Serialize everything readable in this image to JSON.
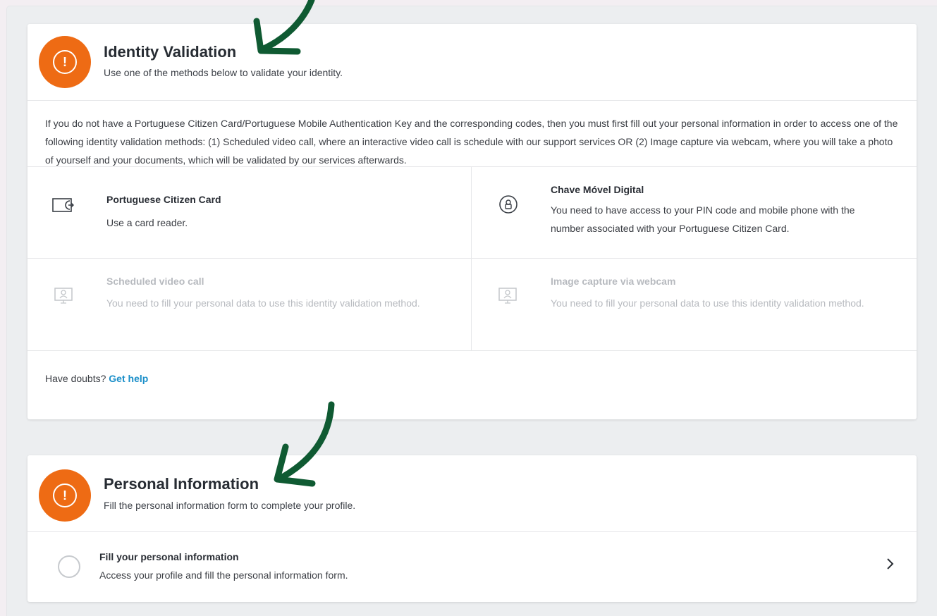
{
  "identity": {
    "title": "Identity Validation",
    "subtitle": "Use one of the methods below to validate your identity.",
    "intro": "If you do not have a Portuguese Citizen Card/Portuguese Mobile Authentication Key and the corresponding codes, then you must first fill out your personal information in order to access one of the following identity validation methods: (1) Scheduled video call, where an interactive video call is schedule with our support services OR (2) Image capture via webcam, where you will take a photo of yourself and your documents, which will be validated by our services afterwards.",
    "methods": [
      {
        "title": "Portuguese Citizen Card",
        "description": "Use a card reader.",
        "icon": "card-reader-icon",
        "enabled": true
      },
      {
        "title": "Chave Móvel Digital",
        "description": "You need to have access to your PIN code and mobile phone with the number associated with your Portuguese Citizen Card.",
        "icon": "lock-icon",
        "enabled": true
      },
      {
        "title": "Scheduled video call",
        "description": "You need to fill your personal data to use this identity validation method.",
        "icon": "video-call-icon",
        "enabled": false
      },
      {
        "title": "Image capture via webcam",
        "description": "You need to fill your personal data to use this identity validation method.",
        "icon": "webcam-icon",
        "enabled": false
      }
    ],
    "help_prefix": "Have doubts?",
    "help_link": "Get help"
  },
  "personal": {
    "title": "Personal Information",
    "subtitle": "Fill the personal information form to complete your profile.",
    "item_title": "Fill your personal information",
    "item_description": "Access your profile and fill the personal information form."
  },
  "colors": {
    "warning": "#ee6b14",
    "link": "#1b8fc9",
    "annotation_arrow": "#0f5a32"
  }
}
